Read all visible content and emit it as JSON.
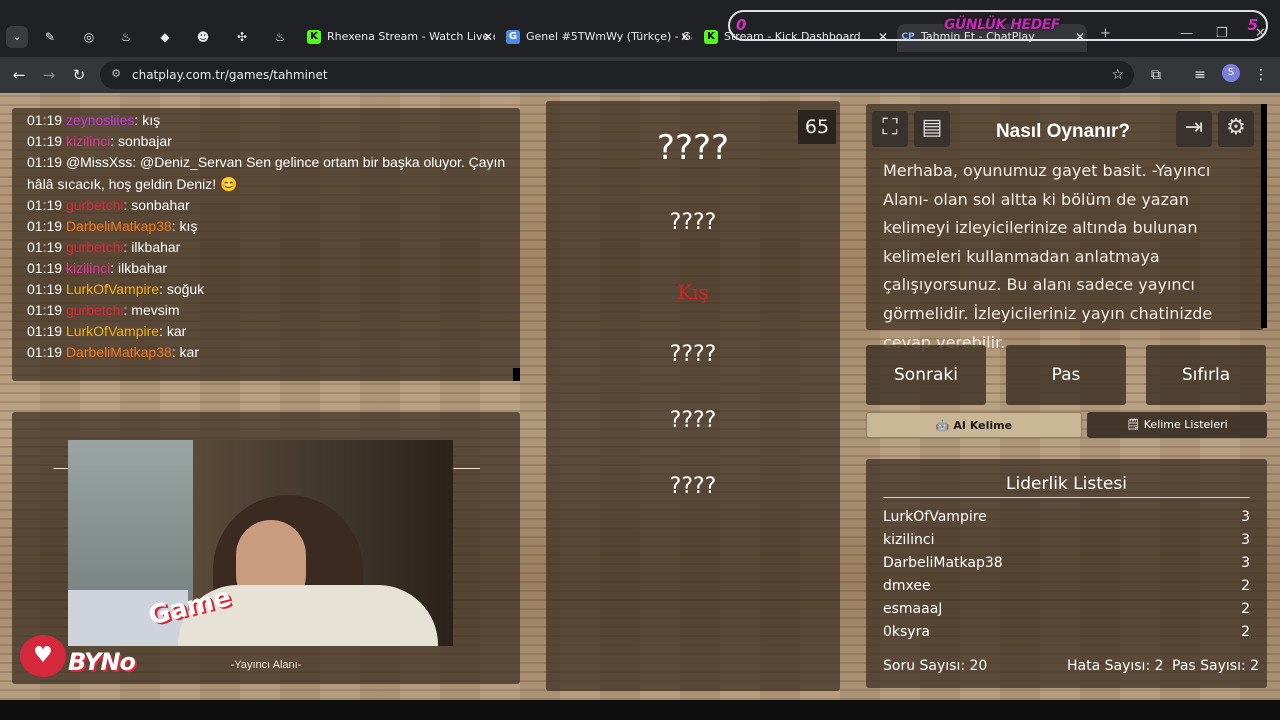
{
  "browser": {
    "tabs": [
      {
        "title": "Rhexena Stream - Watch Live o",
        "favicon": "K"
      },
      {
        "title": "Genel #5TWmWy (Türkçe) - Ga",
        "favicon": "G"
      },
      {
        "title": "Stream - Kick Dashboard",
        "favicon": "K"
      },
      {
        "title": "Tahmin Et - ChatPlay",
        "favicon": "CP"
      }
    ],
    "url": "chatplay.com.tr/games/tahminet",
    "profile_initial": "S"
  },
  "daily_goal": {
    "label": "GÜNLÜK HEDEF",
    "current": "0",
    "target": "5"
  },
  "chat": [
    {
      "time": "01:19",
      "user": "zeynosliies",
      "color": "#c33ad6",
      "message": ": kış"
    },
    {
      "time": "01:19",
      "user": "kizilinci",
      "color": "#e0309a",
      "message": ": sonbajar"
    },
    {
      "time": "01:19",
      "user": "",
      "color": "#ffffff",
      "message": "@MissXss: @Deniz_Servan Sen gelince ortam bir başka oluyor. Çayın"
    },
    {
      "time": "",
      "user": "",
      "color": "#ffffff",
      "message": "hâlâ sıcacık, hoş geldin Deniz! 😊"
    },
    {
      "time": "01:19",
      "user": "gurbetchi",
      "color": "#e0253a",
      "message": ": sonbahar"
    },
    {
      "time": "01:19",
      "user": "DarbeliMatkap38",
      "color": "#f07a2a",
      "message": ": kış"
    },
    {
      "time": "01:19",
      "user": "gurbetchi",
      "color": "#e0253a",
      "message": ": ilkbahar"
    },
    {
      "time": "01:19",
      "user": "kizilinci",
      "color": "#e0309a",
      "message": ": ilkbahar"
    },
    {
      "time": "01:19",
      "user": "LurkOfVampire",
      "color": "#f0b020",
      "message": ": soğuk"
    },
    {
      "time": "01:19",
      "user": "gurbetchi",
      "color": "#e0253a",
      "message": ": mevsim"
    },
    {
      "time": "01:19",
      "user": "LurkOfVampire",
      "color": "#f0b020",
      "message": ": kar"
    },
    {
      "time": "01:19",
      "user": "DarbeliMatkap38",
      "color": "#f07a2a",
      "message": ": kar"
    }
  ],
  "streamer": {
    "label": "-Yayıncı Alanı-",
    "logo_text": "BYNo",
    "logo_game": "Game"
  },
  "game": {
    "counter": "65",
    "words": [
      "????",
      "????",
      "Kış",
      "????",
      "????",
      "????"
    ],
    "target_index": 2
  },
  "how_to": {
    "title": "Nasıl Oynanır?",
    "text": "Merhaba, oyunumuz gayet basit. -Yayıncı Alanı- olan sol altta ki bölüm de yazan kelimeyi izleyicilerinize altında bulunan kelimeleri kullanmadan anlatmaya çalışıyorsunuz. Bu alanı sadece yayıncı görmelidir. İzleyicileriniz yayın chatinizde cevap verebilir."
  },
  "actions": {
    "next": "Sonraki",
    "pass": "Pas",
    "reset": "Sıfırla",
    "ai_word": "AI Kelime",
    "word_lists": "Kelime Listeleri"
  },
  "leaderboard": {
    "title": "Liderlik Listesi",
    "rows": [
      {
        "name": "LurkOfVampire",
        "score": "3"
      },
      {
        "name": "kizilinci",
        "score": "3"
      },
      {
        "name": "DarbeliMatkap38",
        "score": "3"
      },
      {
        "name": "dmxee",
        "score": "2"
      },
      {
        "name": "esmaaaJ",
        "score": "2"
      },
      {
        "name": "0ksyra",
        "score": "2"
      }
    ],
    "question_count": "Soru Sayısı: 20",
    "error_count": "Hata Sayısı: 2",
    "pass_count": "Pas Sayısı: 2"
  }
}
